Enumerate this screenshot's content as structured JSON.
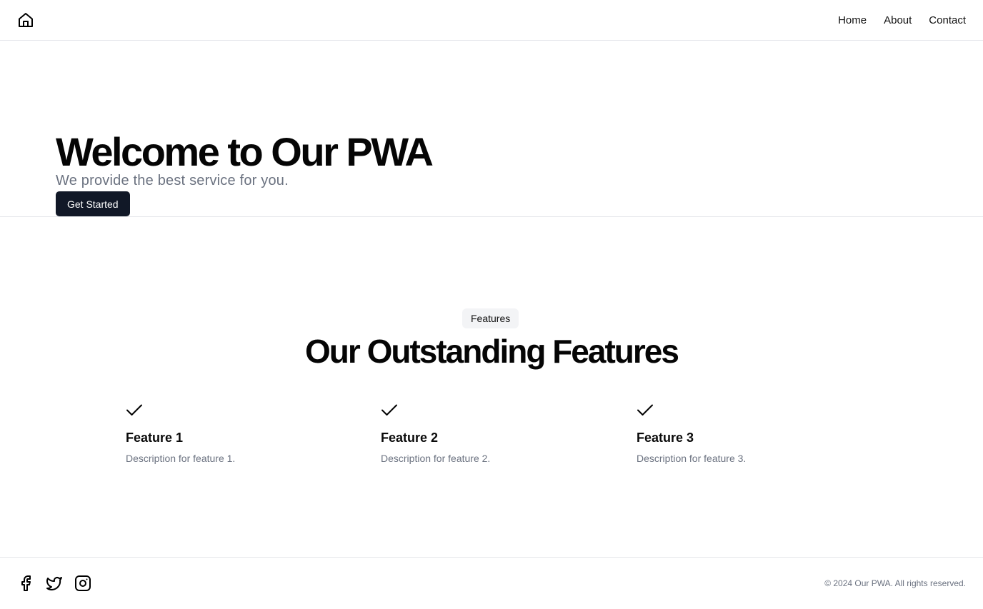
{
  "header": {
    "logo_icon": "home-icon",
    "nav": [
      {
        "label": "Home"
      },
      {
        "label": "About"
      },
      {
        "label": "Contact"
      }
    ]
  },
  "hero": {
    "title": "Welcome to Our PWA",
    "subtitle": "We provide the best service for you.",
    "cta_label": "Get Started"
  },
  "features": {
    "badge": "Features",
    "title": "Our Outstanding Features",
    "items": [
      {
        "icon": "check-icon",
        "title": "Feature 1",
        "description": "Description for feature 1."
      },
      {
        "icon": "check-icon",
        "title": "Feature 2",
        "description": "Description for feature 2."
      },
      {
        "icon": "check-icon",
        "title": "Feature 3",
        "description": "Description for feature 3."
      }
    ]
  },
  "footer": {
    "socials": [
      "facebook-icon",
      "twitter-icon",
      "instagram-icon"
    ],
    "copyright": "© 2024 Our PWA. All rights reserved."
  },
  "colors": {
    "primary_button": "#111827",
    "muted_text": "#6b7280",
    "border": "#e5e7eb",
    "badge_bg": "#f3f4f6"
  }
}
